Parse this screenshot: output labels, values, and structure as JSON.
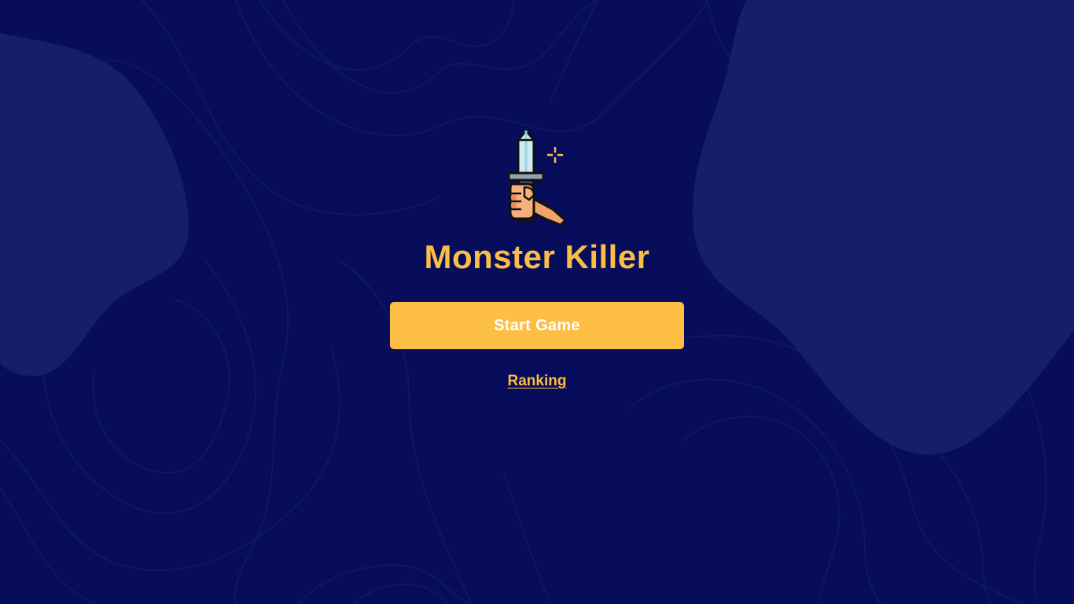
{
  "game": {
    "title": "Monster Killer",
    "logo_icon": "sword-in-hand-icon"
  },
  "menu": {
    "start_label": "Start Game",
    "ranking_label": "Ranking"
  },
  "colors": {
    "background": "#070d5a",
    "blob": "#151e6b",
    "accent": "#fdbe44",
    "button_text": "#ffffff"
  }
}
